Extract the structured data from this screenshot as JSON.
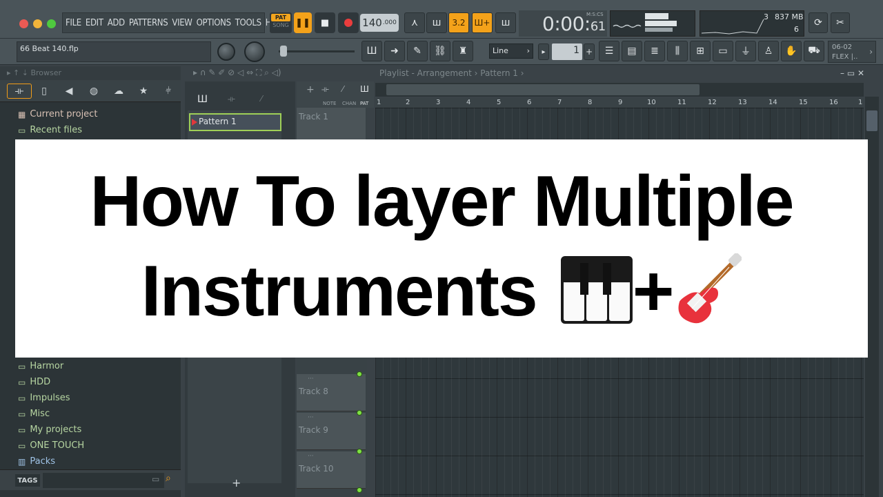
{
  "menu": [
    "FILE",
    "EDIT",
    "ADD",
    "PATTERNS",
    "VIEW",
    "OPTIONS",
    "TOOLS",
    "HELP"
  ],
  "transport": {
    "pat_label": "PAT",
    "song_label": "SONG",
    "pause_icon": "pause-icon",
    "stop_icon": "stop-icon",
    "record_icon": "record-icon",
    "tempo": "140",
    "tempo_decimal": ".000"
  },
  "toolbar1": [
    "metronome-icon",
    "wait-icon",
    "countdown-icon",
    "step-edit-icon",
    "loop-record-icon"
  ],
  "toolbar1_labels": {
    "countdown": "3.2",
    "step_edit": "Ш+"
  },
  "time": {
    "main": "0:00",
    "sub": "61",
    "label": "M:S:CS"
  },
  "cpu": {
    "voices": "3",
    "memory": "837 MB",
    "polyphony": "6"
  },
  "hint_bar": "66 Beat 140.flp",
  "snap": {
    "value": "Line",
    "step": "1"
  },
  "flex_panel": {
    "line1": "06-02",
    "line2": "FLEX |.."
  },
  "browser": {
    "title": "Browser",
    "items_top": [
      {
        "label": "Current project",
        "icon": "project-icon"
      },
      {
        "label": "Recent files",
        "icon": "folder-icon"
      }
    ],
    "items_bottom": [
      {
        "label": "Harmor",
        "icon": "folder-icon"
      },
      {
        "label": "HDD",
        "icon": "folder-icon"
      },
      {
        "label": "Impulses",
        "icon": "folder-icon"
      },
      {
        "label": "Misc",
        "icon": "folder-icon"
      },
      {
        "label": "My projects",
        "icon": "folder-icon"
      },
      {
        "label": "ONE TOUCH",
        "icon": "folder-icon"
      },
      {
        "label": "Packs",
        "icon": "packs-icon"
      }
    ],
    "tags_label": "TAGS"
  },
  "playlist": {
    "title": "Playlist - Arrangement",
    "pattern_crumb": "Pattern 1",
    "pattern_name": "Pattern 1",
    "header_labels": [
      "NOTE",
      "CHAN",
      "PAT"
    ],
    "ruler": [
      "1",
      "2",
      "3",
      "4",
      "5",
      "6",
      "7",
      "8",
      "9",
      "10",
      "11",
      "12",
      "13",
      "14",
      "15",
      "16",
      "1"
    ],
    "tracks_visible": [
      {
        "label": "Track 1"
      },
      {
        "label": "Track 8"
      },
      {
        "label": "Track 9"
      },
      {
        "label": "Track 10"
      }
    ]
  },
  "banner": {
    "line1": "How To layer Multiple",
    "line2": "Instruments",
    "plus": "+",
    "emoji1": "piano-keyboard-emoji",
    "emoji2": "electric-guitar-emoji"
  },
  "colors": {
    "accent": "#f4a21a",
    "led": "#7ee043",
    "pattern_outline": "#9fd057",
    "banner_bg": "#ffffff"
  }
}
